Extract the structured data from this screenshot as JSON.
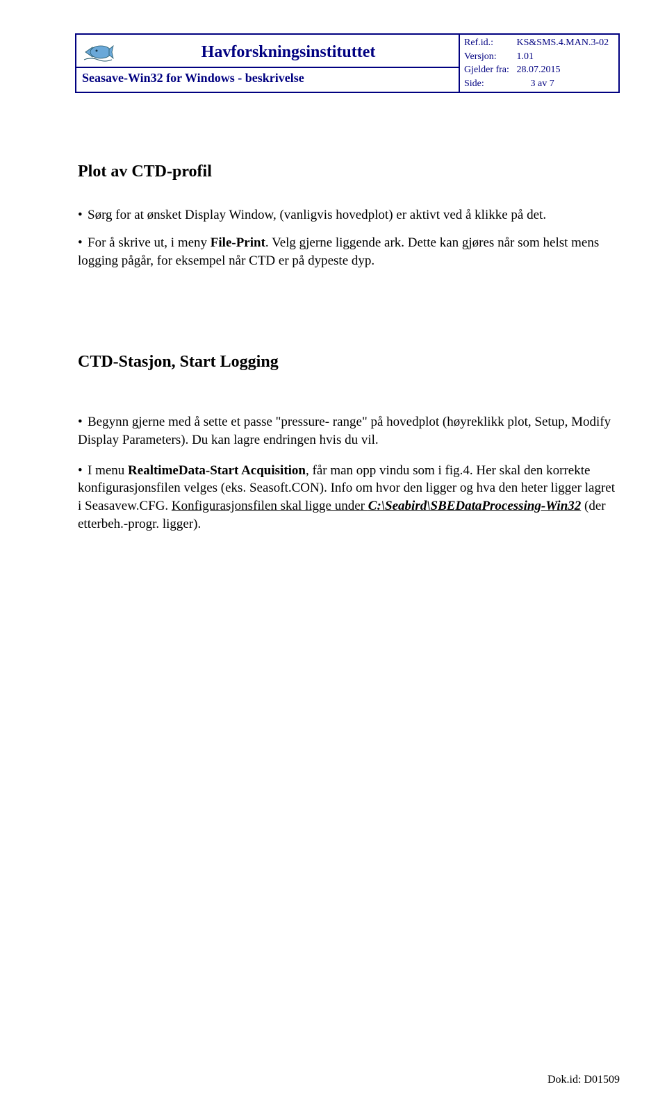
{
  "header": {
    "title": "Havforskningsinstituttet",
    "subtitle": "Seasave-Win32 for Windows - beskrivelse",
    "refid_label": "Ref.id.:",
    "refid_value": "KS&SMS.4.MAN.3-02",
    "version_label": "Versjon:",
    "version_value": "1.01",
    "gjelder_label": "Gjelder fra:",
    "gjelder_value": "28.07.2015",
    "side_label": "Side:",
    "side_value": "3 av 7"
  },
  "section1": {
    "heading": "Plot av CTD-profil",
    "p1_a": "Sørg for at ønsket Display Window, (vanligvis hovedplot) er aktivt ved å klikke på det.",
    "p2_a": "For å skrive ut, i meny ",
    "p2_b": "File-Print",
    "p2_c": ". Velg gjerne liggende ark. Dette kan gjøres når som helst mens logging pågår, for eksempel når CTD er på dypeste dyp."
  },
  "section2": {
    "heading": "CTD-Stasjon, Start Logging",
    "p1_a": "Begynn gjerne med å sette et passe \"pressure- range\" på hovedplot (høyreklikk plot, Setup, Modify Display Parameters). Du kan lagre endringen hvis du vil.",
    "p2_a": "I menu ",
    "p2_b": "RealtimeData-Start Acquisition",
    "p2_c": ", får man opp vindu som i fig.4. Her skal den korrekte konfigurasjonsfilen velges (eks. Seasoft.CON). Info om hvor den ligger og hva den heter ligger lagret  i Seasavew.CFG. ",
    "p2_d": "Konfigurasjonsfilen skal ligge under ",
    "p2_e": "C:\\Seabird\\SBEDataProcessing-Win32",
    "p2_f": " (der etterbeh.-progr. ligger)."
  },
  "footer": {
    "dokid": "Dok.id: D01509"
  }
}
